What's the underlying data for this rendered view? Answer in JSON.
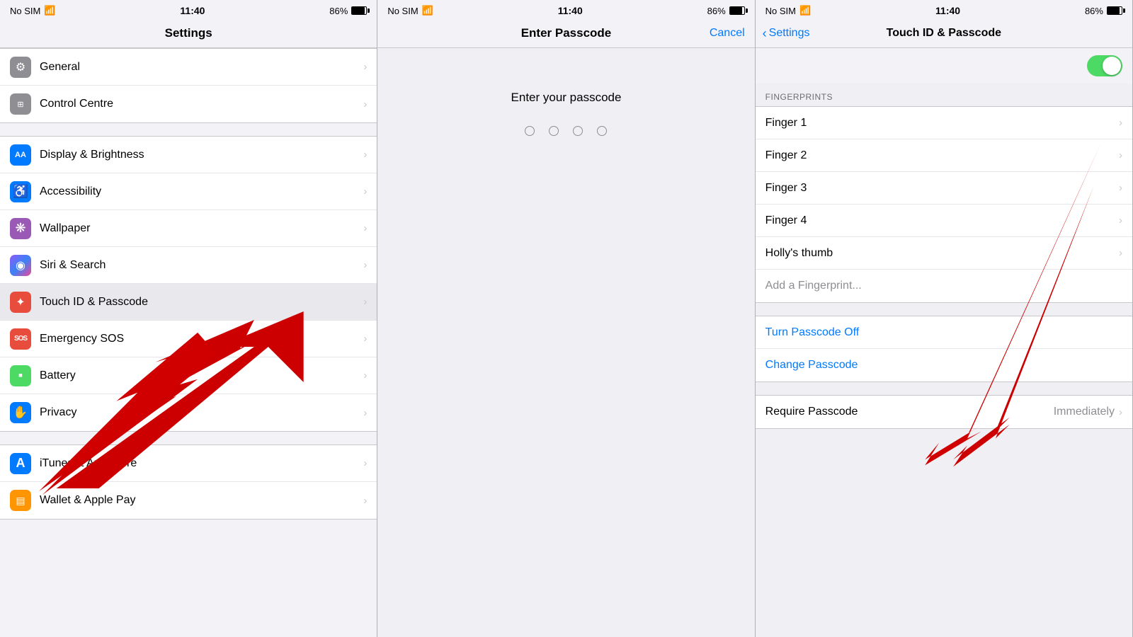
{
  "panel1": {
    "status": {
      "left": "No SIM",
      "time": "11:40",
      "battery": "86%",
      "wifi": true
    },
    "nav_title": "Settings",
    "groups": [
      {
        "items": [
          {
            "id": "general",
            "label": "General",
            "icon": "⚙",
            "iconClass": "icon-general"
          },
          {
            "id": "control",
            "label": "Control Centre",
            "icon": "⊞",
            "iconClass": "icon-control"
          }
        ]
      },
      {
        "items": [
          {
            "id": "display",
            "label": "Display & Brightness",
            "icon": "AA",
            "iconClass": "icon-display"
          },
          {
            "id": "accessibility",
            "label": "Accessibility",
            "icon": "♿",
            "iconClass": "icon-accessibility"
          },
          {
            "id": "wallpaper",
            "label": "Wallpaper",
            "icon": "❋",
            "iconClass": "icon-wallpaper"
          },
          {
            "id": "siri",
            "label": "Siri & Search",
            "icon": "◉",
            "iconClass": "icon-siri"
          },
          {
            "id": "touchid",
            "label": "Touch ID & Passcode",
            "icon": "✦",
            "iconClass": "icon-touchid"
          },
          {
            "id": "emergency",
            "label": "Emergency SOS",
            "icon": "SOS",
            "iconClass": "icon-emergency"
          },
          {
            "id": "battery",
            "label": "Battery",
            "icon": "▪",
            "iconClass": "icon-battery"
          },
          {
            "id": "privacy",
            "label": "Privacy",
            "icon": "✋",
            "iconClass": "icon-privacy"
          }
        ]
      },
      {
        "items": [
          {
            "id": "appstore",
            "label": "iTunes & App Store",
            "icon": "A",
            "iconClass": "icon-appstore"
          },
          {
            "id": "wallet",
            "label": "Wallet & Apple Pay",
            "icon": "▤",
            "iconClass": "icon-wallet"
          }
        ]
      }
    ]
  },
  "panel2": {
    "status": {
      "left": "No SIM",
      "time": "11:40",
      "battery": "86%"
    },
    "nav_title": "Enter Passcode",
    "nav_cancel": "Cancel",
    "prompt": "Enter your passcode",
    "dots": 4
  },
  "panel3": {
    "status": {
      "left": "No SIM",
      "time": "11:40",
      "battery": "86%"
    },
    "nav_back": "Settings",
    "nav_title": "Touch ID & Passcode",
    "sections": [
      {
        "header": "FINGERPRINTS",
        "items": [
          {
            "id": "finger1",
            "label": "Finger 1",
            "type": "nav"
          },
          {
            "id": "finger2",
            "label": "Finger 2",
            "type": "nav"
          },
          {
            "id": "finger3",
            "label": "Finger 3",
            "type": "nav"
          },
          {
            "id": "finger4",
            "label": "Finger 4",
            "type": "nav"
          },
          {
            "id": "hollys",
            "label": "Holly's thumb",
            "type": "nav"
          },
          {
            "id": "addfingerprint",
            "label": "Add a Fingerprint...",
            "type": "plain-gray"
          }
        ]
      },
      {
        "header": "",
        "items": [
          {
            "id": "turnoff",
            "label": "Turn Passcode Off",
            "type": "blue"
          },
          {
            "id": "change",
            "label": "Change Passcode",
            "type": "blue"
          }
        ]
      },
      {
        "header": "",
        "items": [
          {
            "id": "require",
            "label": "Require Passcode",
            "value": "Immediately",
            "type": "nav-value"
          }
        ]
      }
    ]
  },
  "icons": {
    "chevron": "›",
    "wifi": "≋",
    "back_chevron": "‹"
  }
}
